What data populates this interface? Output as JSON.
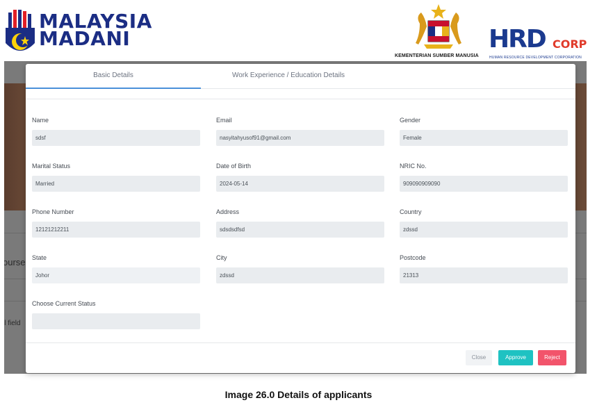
{
  "header": {
    "madani_line1": "MALAYSIA",
    "madani_line2": "MADANI",
    "ministry_text": "KEMENTERIAN SUMBER MANUSIA",
    "hrd_main": "HRD",
    "hrd_corp": "CORP",
    "hrd_sub": "HUMAN RESOURCE DEVELOPMENT CORPORATION"
  },
  "background": {
    "course_fragment": "ourse",
    "field_fragment": "ll field"
  },
  "modal": {
    "tabs": [
      {
        "label": "Basic Details",
        "active": true
      },
      {
        "label": "Work Experience / Education Details",
        "active": false
      }
    ],
    "fields": {
      "name": {
        "label": "Name",
        "value": "sdsf"
      },
      "email": {
        "label": "Email",
        "value": "nasyitahyusof91@gmail.com"
      },
      "gender": {
        "label": "Gender",
        "value": "Female"
      },
      "marital_status": {
        "label": "Marital Status",
        "value": "Married"
      },
      "dob": {
        "label": "Date of Birth",
        "value": "2024-05-14"
      },
      "nric": {
        "label": "NRIC No.",
        "value": "909090909090"
      },
      "phone": {
        "label": "Phone Number",
        "value": "12121212211"
      },
      "address": {
        "label": "Address",
        "value": "sdsdsdfsd"
      },
      "country": {
        "label": "Country",
        "value": "zdssd"
      },
      "state": {
        "label": "State",
        "value": "Johor"
      },
      "city": {
        "label": "City",
        "value": "zdssd"
      },
      "postcode": {
        "label": "Postcode",
        "value": "21313"
      },
      "current_status": {
        "label": "Choose Current Status",
        "value": ""
      }
    },
    "buttons": {
      "close": "Close",
      "approve": "Approve",
      "reject": "Reject"
    },
    "colors": {
      "active_tab": "#4a90d9",
      "approve": "#1fc2c2",
      "reject": "#f2546b"
    }
  },
  "caption": "Image 26.0 Details of applicants"
}
